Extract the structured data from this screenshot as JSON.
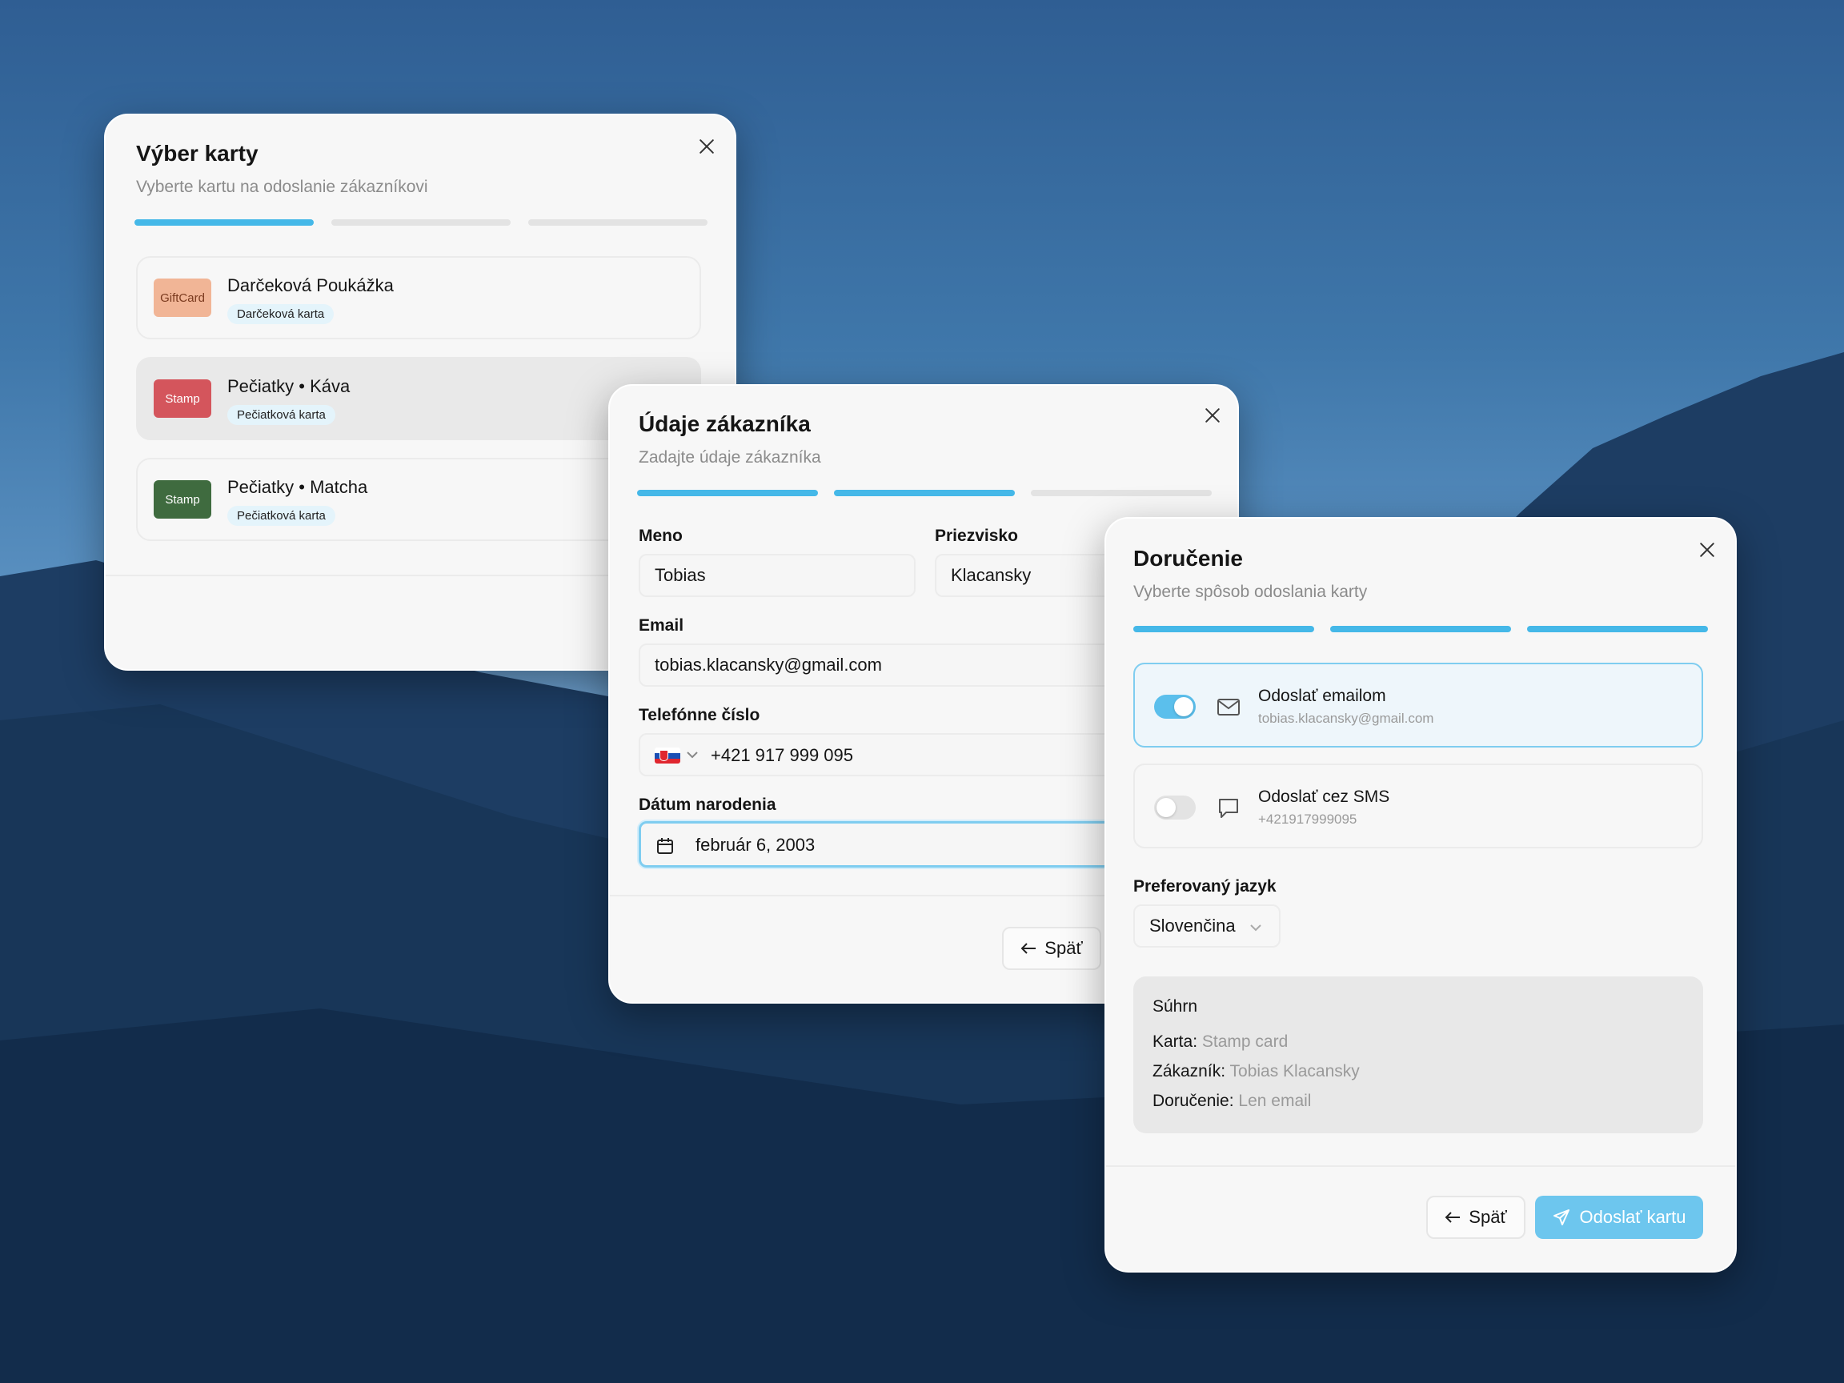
{
  "colors": {
    "accent": "#45b8e8",
    "primary_button": "#6dc6ee",
    "chip_giftcard": "#f1b596",
    "chip_stamp_kava": "#d4555c",
    "chip_stamp_matcha": "#3f6b3f"
  },
  "card_selection": {
    "title": "Výber karty",
    "subtitle": "Vyberte kartu na odoslanie zákazníkovi",
    "progress_steps_active": 1,
    "options": [
      {
        "chip": "GiftCard",
        "title": "Darčeková Poukážka",
        "tag": "Darčeková karta"
      },
      {
        "chip": "Stamp",
        "title": "Pečiatky • Káva",
        "tag": "Pečiatková karta"
      },
      {
        "chip": "Stamp",
        "title": "Pečiatky • Matcha",
        "tag": "Pečiatková karta"
      }
    ]
  },
  "customer": {
    "title": "Údaje zákazníka",
    "subtitle": "Zadajte údaje zákazníka",
    "progress_steps_active": 2,
    "first_name_label": "Meno",
    "first_name_value": "Tobias",
    "last_name_label": "Priezvisko",
    "last_name_value": "Klacansky",
    "email_label": "Email",
    "email_value": "tobias.klacansky@gmail.com",
    "phone_label": "Telefónne číslo",
    "phone_value": "+421 917 999 095",
    "phone_country_icon": "slovakia-flag-icon",
    "birth_label": "Dátum narodenia",
    "birth_value": "február 6, 2003",
    "back_label": "Späť"
  },
  "delivery": {
    "title": "Doručenie",
    "subtitle": "Vyberte spôsob odoslania karty",
    "progress_steps_active": 3,
    "email_option": {
      "title": "Odoslať emailom",
      "detail": "tobias.klacansky@gmail.com",
      "enabled": true,
      "icon": "mail-icon"
    },
    "sms_option": {
      "title": "Odoslať cez SMS",
      "detail": "+421917999095",
      "enabled": false,
      "icon": "message-icon"
    },
    "language_label": "Preferovaný jazyk",
    "language_value": "Slovenčina",
    "summary": {
      "heading": "Súhrn",
      "card_label": "Karta:",
      "card_value": "Stamp card",
      "customer_label": "Zákazník:",
      "customer_value": "Tobias Klacansky",
      "delivery_label": "Doručenie:",
      "delivery_value": "Len email"
    },
    "back_label": "Späť",
    "send_label": "Odoslať kartu"
  }
}
